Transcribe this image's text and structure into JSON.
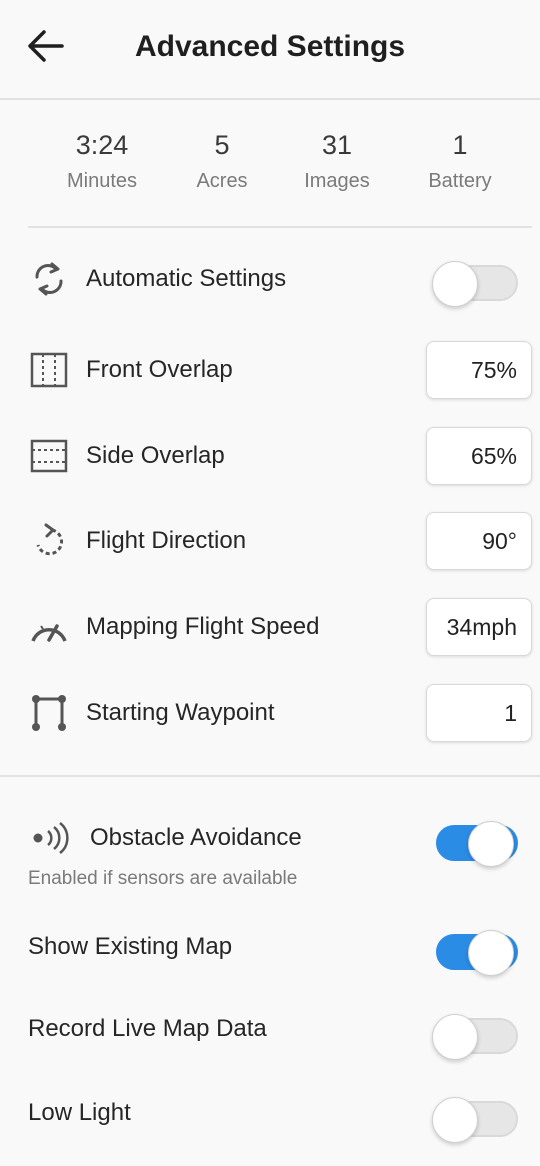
{
  "header": {
    "title": "Advanced Settings",
    "back_icon": "arrow-left-icon"
  },
  "stats": [
    {
      "value": "3:24",
      "label": "Minutes"
    },
    {
      "value": "5",
      "label": "Acres"
    },
    {
      "value": "31",
      "label": "Images"
    },
    {
      "value": "1",
      "label": "Battery"
    }
  ],
  "settings": {
    "automatic": {
      "label": "Automatic Settings",
      "icon": "sync-icon",
      "enabled": false
    },
    "front_overlap": {
      "label": "Front Overlap",
      "icon": "front-overlap-icon",
      "value": "75%"
    },
    "side_overlap": {
      "label": "Side Overlap",
      "icon": "side-overlap-icon",
      "value": "65%"
    },
    "flight_direction": {
      "label": "Flight Direction",
      "icon": "rotate-icon",
      "value": "90°"
    },
    "flight_speed": {
      "label": "Mapping Flight Speed",
      "icon": "speedometer-icon",
      "value": "34mph"
    },
    "starting_waypoint": {
      "label": "Starting Waypoint",
      "icon": "waypoint-icon",
      "value": "1"
    }
  },
  "toggles": {
    "obstacle_avoidance": {
      "label": "Obstacle Avoidance",
      "icon": "sensor-waves-icon",
      "sublabel": "Enabled if sensors are available",
      "enabled": true
    },
    "show_existing_map": {
      "label": "Show Existing Map",
      "enabled": true
    },
    "record_live_map": {
      "label": "Record Live Map Data",
      "enabled": false
    },
    "low_light": {
      "label": "Low Light",
      "enabled": false
    }
  },
  "colors": {
    "accent": "#2b8ce6",
    "text": "#262626",
    "muted": "#7a7a7a"
  }
}
